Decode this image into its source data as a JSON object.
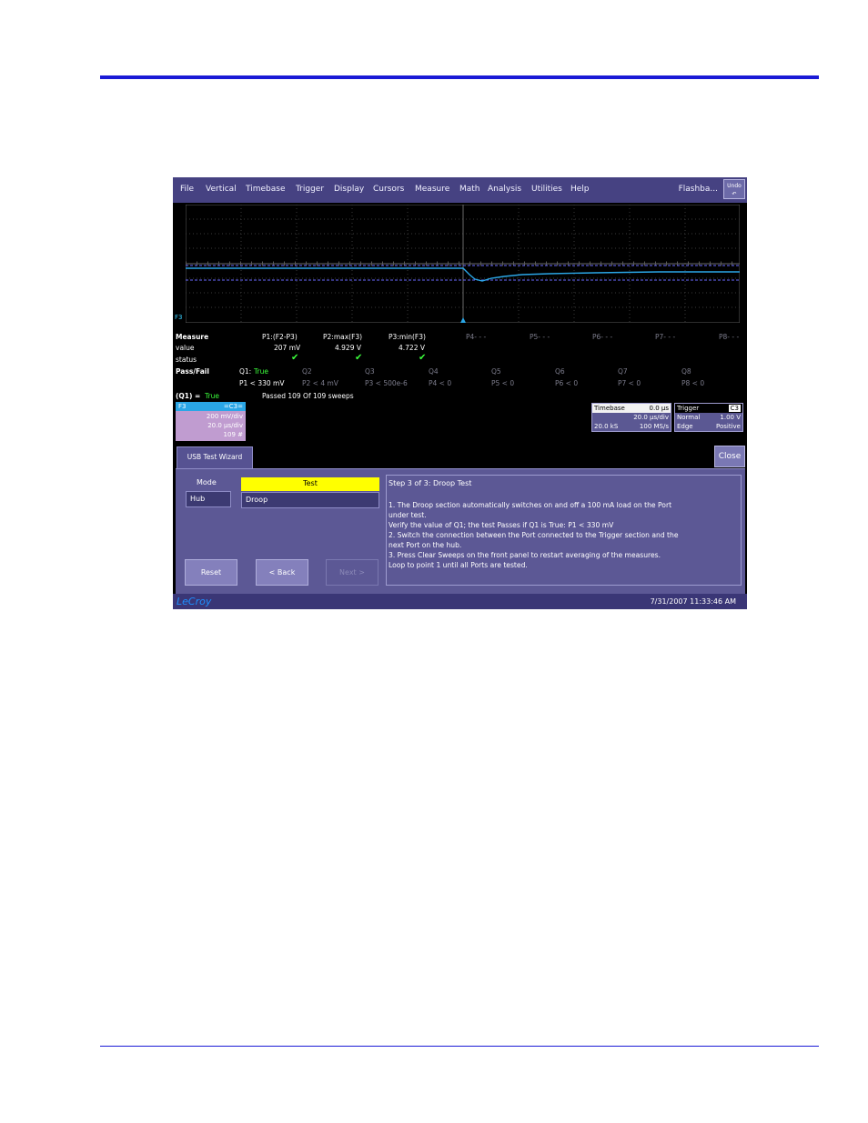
{
  "menu": {
    "items": [
      "File",
      "Vertical",
      "Timebase",
      "Trigger",
      "Display",
      "Cursors",
      "Measure",
      "Math",
      "Analysis",
      "Utilities",
      "Help"
    ],
    "right_label": "Flashba...",
    "undo_label": "Undo"
  },
  "trace": {
    "label": "F3"
  },
  "measure": {
    "title": "Measure",
    "row_labels": {
      "value": "value",
      "status": "status"
    },
    "params": [
      {
        "name": "P1:(F2-P3)",
        "value": "207 mV",
        "status": "✔"
      },
      {
        "name": "P2:max(F3)",
        "value": "4.929 V",
        "status": "✔"
      },
      {
        "name": "P3:min(F3)",
        "value": "4.722 V",
        "status": "✔"
      }
    ],
    "empty_params": [
      "P4- - -",
      "P5- - -",
      "P6- - -",
      "P7- - -",
      "P8- - -"
    ]
  },
  "passfail": {
    "title": "Pass/Fail",
    "q1_label": "Q1:",
    "q1_state": "True",
    "tests": [
      {
        "name": "Q2",
        "cond": "P2 < 4 mV"
      },
      {
        "name": "Q3",
        "cond": "P3 < 500e-6"
      },
      {
        "name": "Q4",
        "cond": "P4 < 0"
      },
      {
        "name": "Q5",
        "cond": "P5 < 0"
      },
      {
        "name": "Q6",
        "cond": "P6 < 0"
      },
      {
        "name": "Q7",
        "cond": "P7 < 0"
      },
      {
        "name": "Q8",
        "cond": "P8 < 0"
      }
    ],
    "q1_cond": "P1 < 330 mV",
    "summary_label": "(Q1) =",
    "summary_state": "True",
    "summary_text": "Passed  109  Of  109   sweeps"
  },
  "f3_box": {
    "name": "F3",
    "source": "=C3=",
    "vdiv": "200 mV/div",
    "tdiv": "20.0 µs/div",
    "sweeps": "109 #"
  },
  "timebase": {
    "title": "Timebase",
    "delay": "0.0 µs",
    "tdiv": "20.0 µs/div",
    "samples": "20.0 kS",
    "rate": "100 MS/s"
  },
  "trigger": {
    "title": "Trigger",
    "channel": "C3",
    "mode": "Normal",
    "level": "1.00 V",
    "type": "Edge",
    "slope": "Positive"
  },
  "wizard": {
    "tab_label": "USB Test Wizard",
    "close_label": "Close",
    "mode_label": "Mode",
    "mode_value": "Hub",
    "test_label": "Test",
    "test_value": "Droop",
    "buttons": {
      "reset": "Reset",
      "back": "< Back",
      "next": "Next >"
    },
    "step_title": "Step  3 of 3: Droop Test",
    "instructions": [
      "1. The Droop section automatically switches on and off a 100 mA load on the Port",
      "    under test.",
      "    Verify the value of Q1; the test Passes if Q1 is True: P1 < 330 mV",
      "2. Switch the connection between the Port connected to the Trigger section and the",
      "    next Port on the hub.",
      "3. Press Clear Sweeps on the front panel to restart averaging of the measures.",
      "    Loop to point 1 until all Ports are tested."
    ]
  },
  "status_bar": {
    "logo": "LeCroy",
    "timestamp": "7/31/2007 11:33:46 AM"
  },
  "colors": {
    "menubar": "#464282",
    "trace": "#2aa6e6",
    "pass_green": "#3cff3c",
    "highlight_yellow": "#ffff00",
    "page_rule_blue": "#1a1ad6"
  }
}
